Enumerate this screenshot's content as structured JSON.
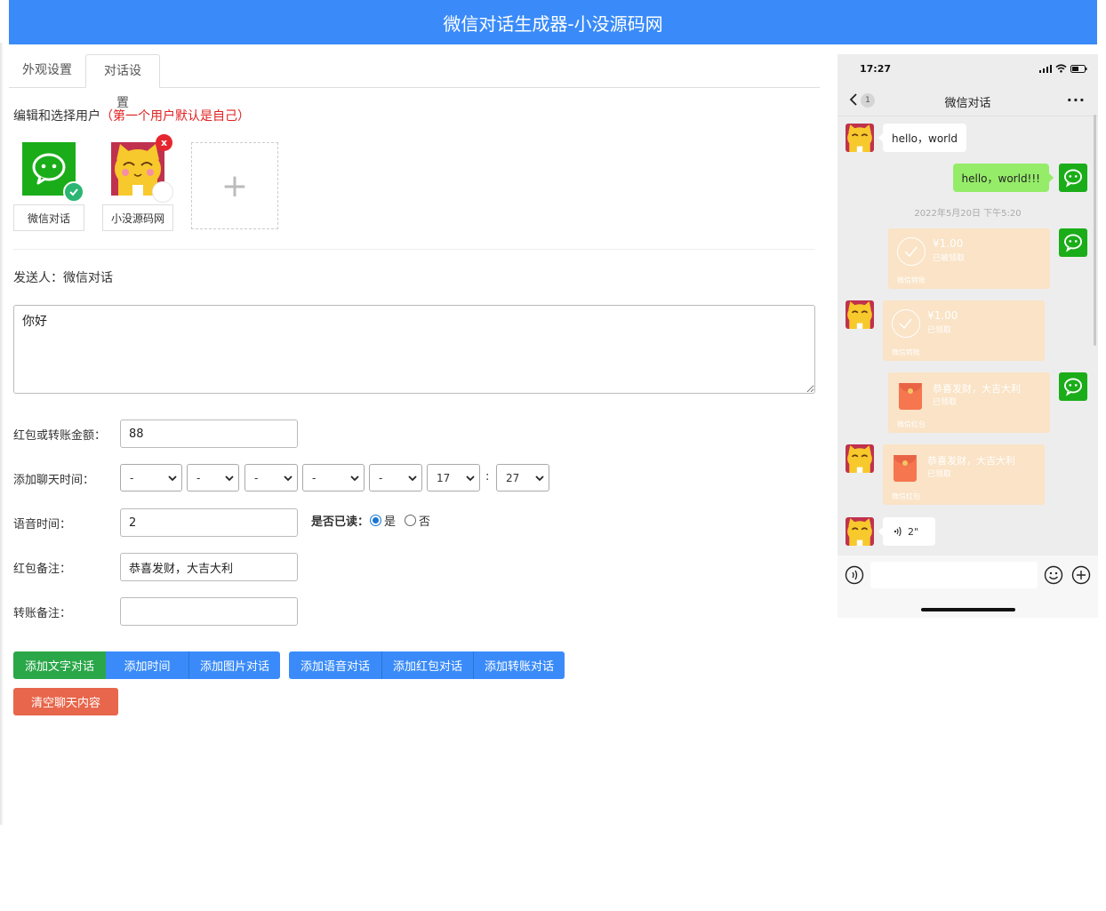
{
  "header": {
    "title": "微信对话生成器-小没源码网"
  },
  "tabs": [
    {
      "label": "外观设置"
    },
    {
      "label": "对话设置"
    }
  ],
  "user_section": {
    "label": "编辑和选择用户",
    "note": "（第一个用户默认是自己）"
  },
  "users": [
    {
      "name": "微信对话",
      "selected": true,
      "avatar": "wechat-logo-icon"
    },
    {
      "name": "小没源码网",
      "selected": false,
      "avatar": "cat-avatar",
      "delete_label": "x"
    }
  ],
  "add_user_symbol": "+",
  "sender": {
    "label": "发送人：",
    "name": "微信对话"
  },
  "message_text": "你好",
  "form": {
    "amount_label": "红包或转账金额：",
    "amount_value": "88",
    "time_label": "添加聊天时间：",
    "time_selects": [
      "-",
      "-",
      "-",
      "-",
      "-",
      "17",
      "27"
    ],
    "time_colon": ":",
    "voice_label": "语音时间：",
    "voice_value": "2",
    "read_label": "是否已读：",
    "read_yes": "是",
    "read_no": "否",
    "read_selected": "是",
    "hongbao_note_label": "红包备注：",
    "hongbao_note_value": "恭喜发财，大吉大利",
    "transfer_note_label": "转账备注：",
    "transfer_note_value": ""
  },
  "buttons": {
    "add_text": "添加文字对话",
    "add_time": "添加时间",
    "add_image": "添加图片对话",
    "add_voice": "添加语音对话",
    "add_hongbao": "添加红包对话",
    "add_transfer": "添加转账对话",
    "clear": "清空聊天内容"
  },
  "phone": {
    "status_time": "17:27",
    "nav_title": "微信对话",
    "nav_badge": "1",
    "nav_more": "···",
    "messages": [
      {
        "side": "left",
        "type": "text",
        "text": "hello，world"
      },
      {
        "side": "right",
        "type": "text",
        "text": "hello，world!!!"
      },
      {
        "type": "timestamp",
        "text": "2022年5月20日 下午5:20"
      },
      {
        "side": "right",
        "type": "transfer",
        "amount": "¥1.00",
        "status": "已被领取",
        "footer": "微信转账"
      },
      {
        "side": "left",
        "type": "transfer",
        "amount": "¥1.00",
        "status": "已领取",
        "footer": "微信转账"
      },
      {
        "side": "right",
        "type": "hongbao",
        "text": "恭喜发财，大吉大利",
        "status": "已领取",
        "footer": "微信红包"
      },
      {
        "side": "left",
        "type": "hongbao",
        "text": "恭喜发财，大吉大利",
        "status": "已领取",
        "footer": "微信红包"
      },
      {
        "side": "left",
        "type": "voice",
        "text": "2\""
      }
    ]
  },
  "colors": {
    "primary": "#3a8bf9",
    "green_button": "#2aa749",
    "danger": "#e8664b",
    "wechat_green": "#1aad19",
    "bubble_green": "#95ec69"
  }
}
